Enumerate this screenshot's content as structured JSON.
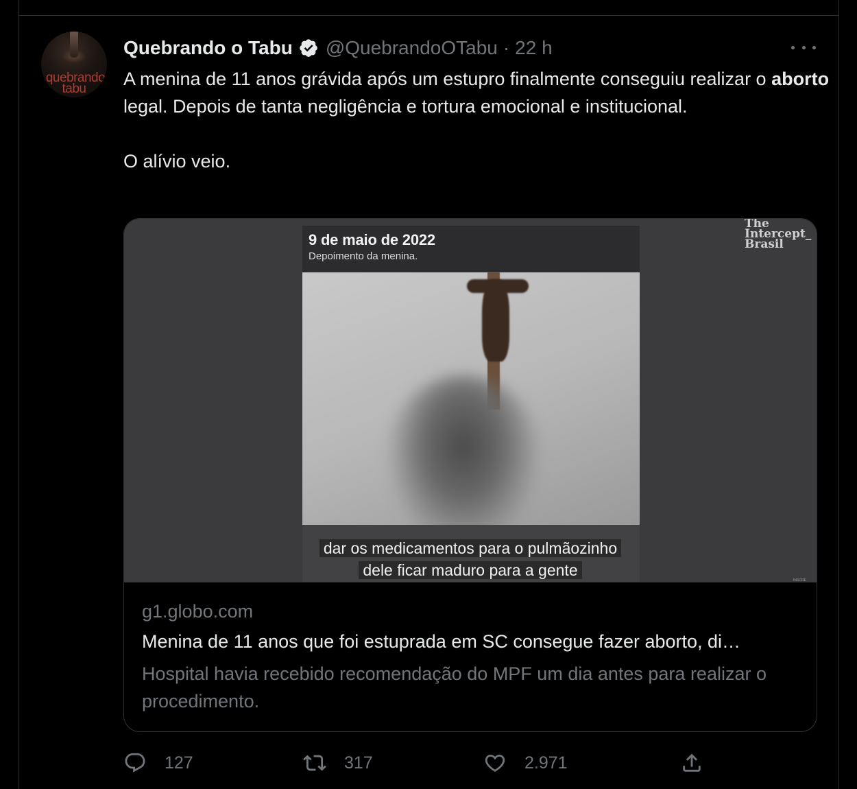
{
  "tweet": {
    "avatar_text_line1": "quebrando",
    "avatar_text_line2": "tabu",
    "display_name": "Quebrando o Tabu",
    "handle": "@QuebrandoOTabu",
    "separator": "·",
    "time": "22 h",
    "text_before_bold": "A menina de 11 anos grávida após um estupro finalmente conseguiu realizar o ",
    "text_bold": "aborto",
    "text_after_bold": " legal. Depois de tanta negligência e tortura emocional e institucional.",
    "text_paragraph2": "O alívio veio."
  },
  "card": {
    "video_date": "9 de maio de 2022",
    "video_subtitle": "Depoimento da menina.",
    "caption_line1": "dar os medicamentos para o pulmãozinho",
    "caption_line2": "dele ficar maduro para a gente",
    "watermark_line1": "The",
    "watermark_line2": "Intercept_",
    "watermark_line3": "Brasil",
    "watermark_small": "INSCRE",
    "domain": "g1.globo.com",
    "title": "Menina de 11 anos que foi estuprada em SC consegue fazer aborto, di…",
    "description": "Hospital havia recebido recomendação do MPF um dia antes para realizar o procedimento."
  },
  "actions": {
    "replies": "127",
    "retweets": "317",
    "likes": "2.971"
  },
  "icons": {
    "verified": "verified-badge-icon",
    "more": "more-icon",
    "reply": "reply-icon",
    "retweet": "retweet-icon",
    "like": "heart-icon",
    "share": "share-icon"
  },
  "colors": {
    "background": "#000000",
    "text_primary": "#e7e9ea",
    "text_secondary": "#71767b",
    "border": "#2f3336",
    "avatar_text": "#b33a2e"
  }
}
